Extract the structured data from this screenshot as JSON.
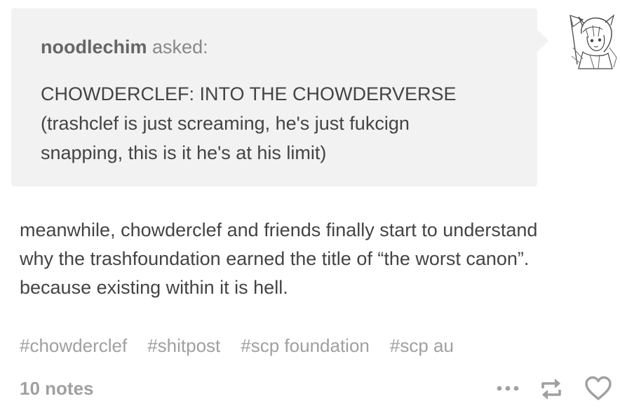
{
  "ask": {
    "asker_name": "noodlechim",
    "asked_label": "asked:",
    "question": "CHOWDERCLEF: INTO THE CHOWDERVERSE\n(trashclef is just screaming, he's just fukcign\nsnapping, this is it he's at his limit)",
    "avatar_icon": "anime-character-avatar-icon"
  },
  "answer": {
    "text": "meanwhile, chowderclef and friends finally start to understand\nwhy the trashfoundation earned the title of “the worst canon”.\nbecause existing within it is hell."
  },
  "tags": [
    {
      "label": "#chowderclef"
    },
    {
      "label": "#shitpost"
    },
    {
      "label": "#scp foundation"
    },
    {
      "label": "#scp au"
    }
  ],
  "footer": {
    "notes": "10 notes",
    "icons": {
      "more": "more-options-icon",
      "reblog": "reblog-icon",
      "like": "heart-icon"
    },
    "icon_color": "#a0a0a0"
  }
}
